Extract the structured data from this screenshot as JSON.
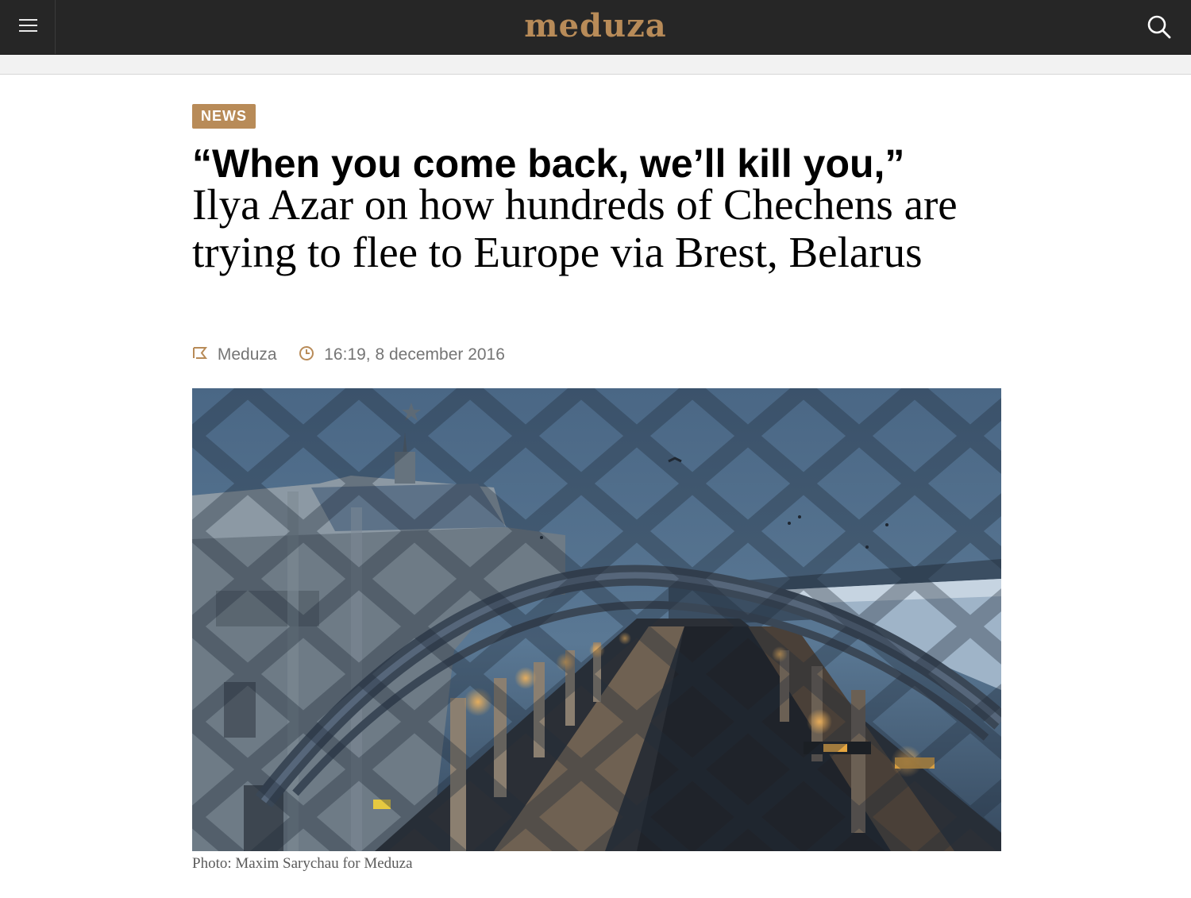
{
  "header": {
    "logo": "meduza",
    "menu_icon": "hamburger-menu-icon",
    "search_icon": "search-icon",
    "background": "#262626",
    "accent": "#b88b58"
  },
  "article": {
    "rubric": "NEWS",
    "headline": "“When you come back, we’ll kill you,”",
    "subhead": "Ilya Azar on how hundreds of Chechens are trying to flee to Europe via Brest, Belarus",
    "source_icon": "source-flag-icon",
    "source": "Meduza",
    "time_icon": "clock-icon",
    "timestamp": "16:19, 8 december 2016",
    "photo_caption": "Photo: Maxim Sarychau for Meduza"
  }
}
